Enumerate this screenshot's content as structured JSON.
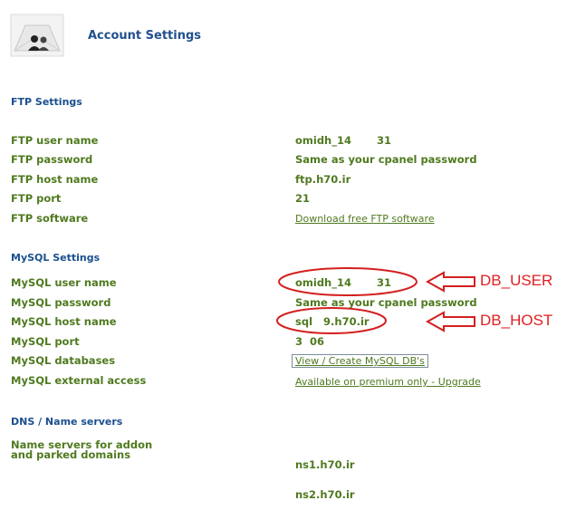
{
  "header": {
    "title": "Account Settings",
    "logo_icon": "users-envelope-icon"
  },
  "ftp": {
    "section_title": "FTP Settings",
    "user_label": "FTP user name",
    "user_value": "omidh_14       31",
    "password_label": "FTP password",
    "password_value": "Same as your cpanel password",
    "host_label": "FTP host name",
    "host_value": "ftp.h70.ir",
    "port_label": "FTP port",
    "port_value": "21",
    "software_label": "FTP software",
    "software_link": "Download free FTP software"
  },
  "mysql": {
    "section_title": "MySQL Settings",
    "user_label": "MySQL user name",
    "user_value": "omidh_14       31",
    "password_label": "MySQL password",
    "password_value": "Same as your cpanel password",
    "host_label": "MySQL host name",
    "host_value": "sql   9.h70.ir",
    "port_label": "MySQL port",
    "port_value": "3  06",
    "databases_label": "MySQL databases",
    "databases_link": "View / Create MySQL DB's",
    "external_label": "MySQL external access",
    "external_link": "Available on premium only - Upgrade"
  },
  "dns": {
    "section_title": "DNS / Name servers",
    "label_line1": "Name servers for addon",
    "label_line2": "and parked domains",
    "ns1": "ns1.h70.ir",
    "ns2": "ns2.h70.ir"
  },
  "annotations": {
    "db_user": "DB_USER",
    "db_host": "DB_HOST",
    "color": "#e02020"
  },
  "colors": {
    "label_green": "#4f7a1f",
    "section_blue": "#1a4f8f"
  }
}
